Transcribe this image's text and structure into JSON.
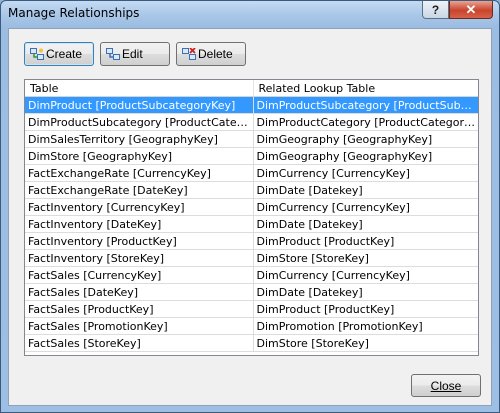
{
  "window": {
    "title": "Manage Relationships",
    "help_glyph": "?",
    "close_glyph": "✕"
  },
  "toolbar": {
    "create_label": "Create",
    "edit_label": "Edit",
    "delete_label": "Delete"
  },
  "table": {
    "columns": [
      "Table",
      "Related Lookup Table"
    ],
    "selected_row": 0,
    "rows": [
      [
        "DimProduct [ProductSubcategoryKey]",
        "DimProductSubcategory [ProductSubcategoryKey]"
      ],
      [
        "DimProductSubcategory [ProductCategoryKey]",
        "DimProductCategory [ProductCategoryKey]"
      ],
      [
        "DimSalesTerritory [GeographyKey]",
        "DimGeography [GeographyKey]"
      ],
      [
        "DimStore [GeographyKey]",
        "DimGeography [GeographyKey]"
      ],
      [
        "FactExchangeRate [CurrencyKey]",
        "DimCurrency [CurrencyKey]"
      ],
      [
        "FactExchangeRate [DateKey]",
        "DimDate [Datekey]"
      ],
      [
        "FactInventory [CurrencyKey]",
        "DimCurrency [CurrencyKey]"
      ],
      [
        "FactInventory [DateKey]",
        "DimDate [Datekey]"
      ],
      [
        "FactInventory [ProductKey]",
        "DimProduct [ProductKey]"
      ],
      [
        "FactInventory [StoreKey]",
        "DimStore [StoreKey]"
      ],
      [
        "FactSales [CurrencyKey]",
        "DimCurrency [CurrencyKey]"
      ],
      [
        "FactSales [DateKey]",
        "DimDate [Datekey]"
      ],
      [
        "FactSales [ProductKey]",
        "DimProduct [ProductKey]"
      ],
      [
        "FactSales [PromotionKey]",
        "DimPromotion [PromotionKey]"
      ],
      [
        "FactSales [StoreKey]",
        "DimStore [StoreKey]"
      ]
    ]
  },
  "footer": {
    "close_label": "Close"
  }
}
